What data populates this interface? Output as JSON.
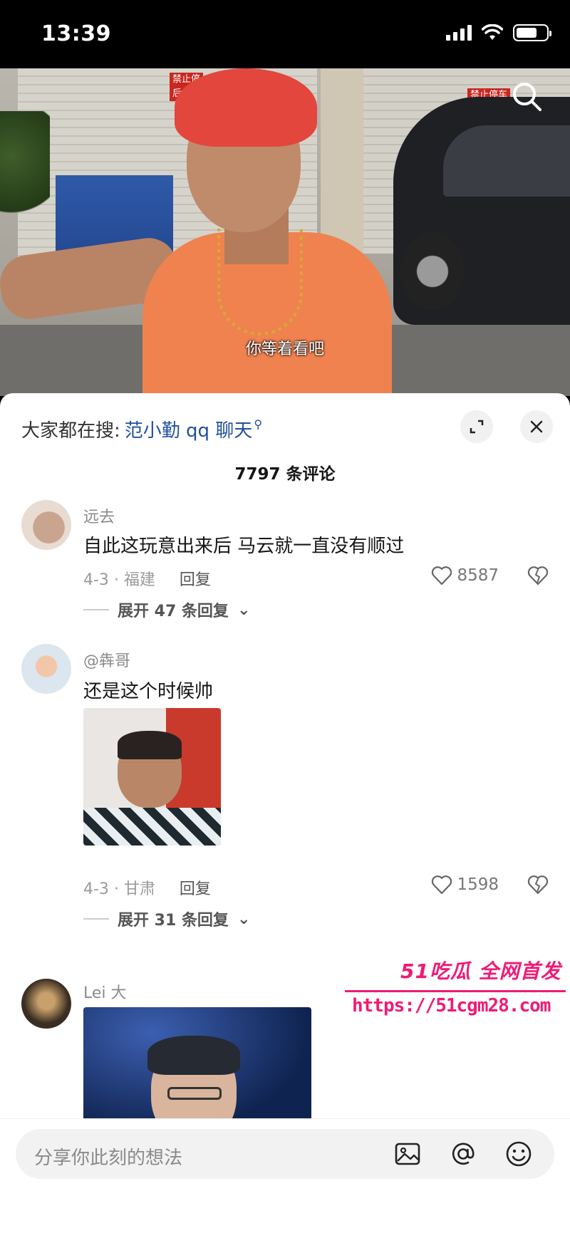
{
  "status_bar": {
    "time": "13:39"
  },
  "video": {
    "subtitle": "你等着看吧",
    "signs": [
      "禁止停",
      "后果自",
      "禁止停车"
    ]
  },
  "comments_panel": {
    "search_prefix": "大家都在搜:",
    "search_keyword": "范小勤 qq 聊天",
    "comment_count": "7797 条评论"
  },
  "comments": [
    {
      "username": "远去",
      "text": "自此这玩意出来后 马云就一直没有顺过",
      "date_location": "4-3 · 福建",
      "reply_label": "回复",
      "likes": "8587",
      "expand_label": "展开 47 条回复"
    },
    {
      "username": "@犇哥",
      "text": "还是这个时候帅",
      "date_location": "4-3 · 甘肃",
      "reply_label": "回复",
      "likes": "1598",
      "expand_label": "展开 31 条回复"
    },
    {
      "username": "Lei 大"
    }
  ],
  "watermark": {
    "brand": "51吃瓜 全网首发",
    "url": "https://51cgm28.com"
  },
  "input": {
    "placeholder": "分享你此刻的想法"
  },
  "icons": {
    "search": "search-icon",
    "fullscreen": "expand-icon",
    "close": "close-icon",
    "like": "heart-icon",
    "dislike": "broken-heart-icon",
    "image": "image-icon",
    "mention": "at-icon",
    "emoji": "emoji-icon"
  },
  "colors": {
    "keyword": "#1f4fa0",
    "watermark": "#ef1b76"
  }
}
